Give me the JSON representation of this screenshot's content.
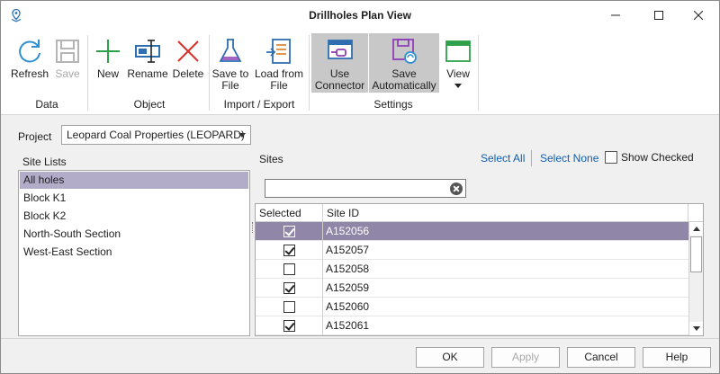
{
  "window": {
    "title": "Drillholes Plan View"
  },
  "ribbon": {
    "buttons": {
      "refresh": "Refresh",
      "save": "Save",
      "new": "New",
      "rename": "Rename",
      "delete": "Delete",
      "save_to_file_1": "Save to",
      "save_to_file_2": "File",
      "load_from_file_1": "Load from",
      "load_from_file_2": "File",
      "use_connector_1": "Use",
      "use_connector_2": "Connector",
      "save_auto_1": "Save",
      "save_auto_2": "Automatically",
      "view": "View"
    },
    "groups": {
      "data": "Data",
      "object": "Object",
      "import_export": "Import / Export",
      "settings": "Settings"
    }
  },
  "project": {
    "label": "Project",
    "selected": "Leopard Coal Properties (LEOPARD)"
  },
  "site_lists": {
    "label": "Site Lists",
    "items": [
      "All holes",
      "Block K1",
      "Block K2",
      "North-South Section",
      "West-East Section"
    ]
  },
  "sites": {
    "label": "Sites",
    "select_all": "Select All",
    "select_none": "Select None",
    "show_checked": "Show Checked",
    "search_value": "",
    "columns": [
      "Selected",
      "Site ID"
    ],
    "rows": [
      {
        "id": "A152056",
        "checked": true
      },
      {
        "id": "A152057",
        "checked": true
      },
      {
        "id": "A152058",
        "checked": false
      },
      {
        "id": "A152059",
        "checked": true
      },
      {
        "id": "A152060",
        "checked": false
      },
      {
        "id": "A152061",
        "checked": true
      }
    ]
  },
  "footer": {
    "ok": "OK",
    "apply": "Apply",
    "cancel": "Cancel",
    "help": "Help"
  },
  "colors": {
    "accent_link": "#0f5fb3",
    "selection": "#8f86a8",
    "list_selection": "#b3acc9"
  }
}
